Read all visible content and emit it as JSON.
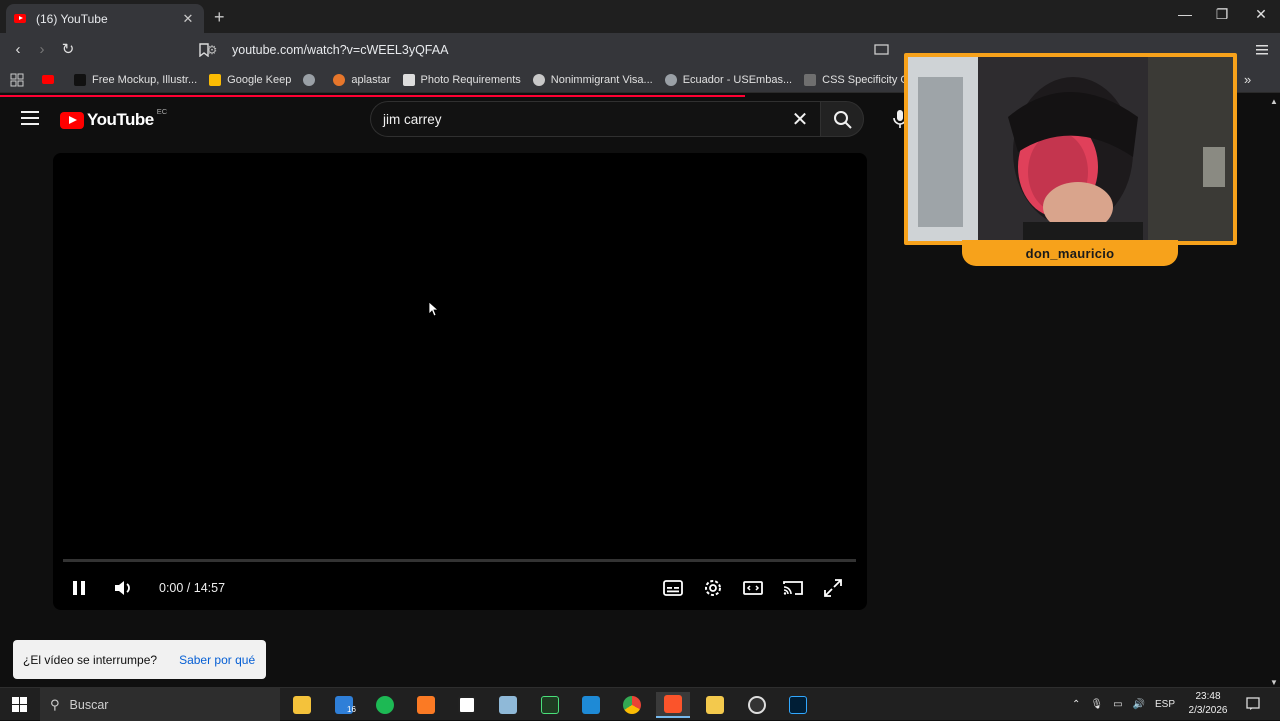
{
  "browser": {
    "tab": {
      "title": "(16) YouTube",
      "close": "✕"
    },
    "new_tab": "+",
    "window_controls": {
      "minimize": "—",
      "maximize": "❐",
      "close": "✕"
    },
    "url": "youtube.com/watch?v=cWEEL3yQFAA",
    "bookmarks": [
      {
        "label": "Free Mockup, Illustr...",
        "color": "#111111"
      },
      {
        "label": "Google Keep",
        "color": "#fbbc04"
      },
      {
        "label": "aplastar",
        "color": "#e6762b"
      },
      {
        "label": "Photo Requirements",
        "color": "#dddddd"
      },
      {
        "label": "Nonimmigrant Visa...",
        "color": "#c8c8c8"
      },
      {
        "label": "Ecuador - USEmbas...",
        "color": "#9aa0a6"
      },
      {
        "label": "CSS Specificity Grap...",
        "color": "#6f6f6f"
      }
    ],
    "more_bookmarks": "»"
  },
  "youtube": {
    "logo_text": "YouTube",
    "country": "EC",
    "search_query": "jim carrey",
    "player": {
      "time": "0:00 / 14:57",
      "progress": 0
    },
    "notice": {
      "message": "¿El vídeo se interrumpe?",
      "link": "Saber por qué"
    }
  },
  "webcam": {
    "streamer_name": "don_mauricio"
  },
  "taskbar": {
    "search_label": "Buscar",
    "badge_count": "16",
    "language": "ESP",
    "time": "23:48",
    "date": "2/3/2026"
  },
  "colors": {
    "youtube_red": "#ff0000",
    "webcam_frame": "#f7a21b",
    "link_blue": "#065fd4"
  }
}
